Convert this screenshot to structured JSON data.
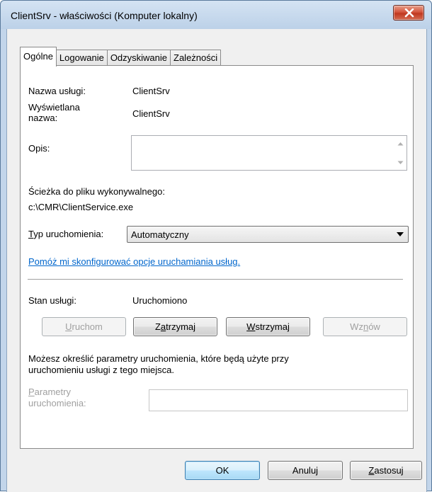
{
  "window": {
    "title": "ClientSrv - właściwości (Komputer lokalny)"
  },
  "tabs": [
    {
      "label": "Ogólne",
      "active": true
    },
    {
      "label": "Logowanie",
      "active": false
    },
    {
      "label": "Odzyskiwanie",
      "active": false
    },
    {
      "label": "Zależności",
      "active": false
    }
  ],
  "general": {
    "service_name_label": "Nazwa usługi:",
    "service_name_value": "ClientSrv",
    "display_name_label_line1": "Wyświetlana",
    "display_name_label_line2": "nazwa:",
    "display_name_value": "ClientSrv",
    "description_label": "Opis:",
    "description_value": "",
    "exe_path_label": "Ścieżka do pliku wykonywalnego:",
    "exe_path_value": "c:\\CMR\\ClientService.exe",
    "startup_type_label_accel": "T",
    "startup_type_label_rest": "yp uruchomienia:",
    "startup_type_value": "Automatyczny",
    "help_link": "Pomóż mi skonfigurować opcje uruchamiania usług.",
    "status_label": "Stan usługi:",
    "status_value": "Uruchomiono",
    "start_params_text_line1": "Możesz określić parametry uruchomienia, które będą użyte przy",
    "start_params_text_line2": "uruchomieniu usługi z tego miejsca.",
    "start_params_label_line1_accel": "P",
    "start_params_label_line1_rest": "arametry",
    "start_params_label_line2": "uruchomienia:",
    "start_params_value": ""
  },
  "service_buttons": {
    "start": {
      "pre": "",
      "accel": "U",
      "post": "ruchom",
      "enabled": false
    },
    "stop": {
      "pre": "Z",
      "accel": "a",
      "post": "trzymaj",
      "enabled": true
    },
    "pause": {
      "pre": "",
      "accel": "W",
      "post": "strzymaj",
      "enabled": true
    },
    "resume": {
      "pre": "Wz",
      "accel": "n",
      "post": "ów",
      "enabled": false
    }
  },
  "dialog_buttons": {
    "ok": "OK",
    "cancel": "Anuluj",
    "apply_accel": "Z",
    "apply_rest": "astosuj"
  },
  "colors": {
    "link": "#0066cc",
    "disabled_text": "#a0a0a0",
    "close_button": "#c0381f"
  },
  "icons": [
    "close-icon",
    "scroll-up-icon",
    "scroll-down-icon",
    "chevron-down-icon"
  ]
}
